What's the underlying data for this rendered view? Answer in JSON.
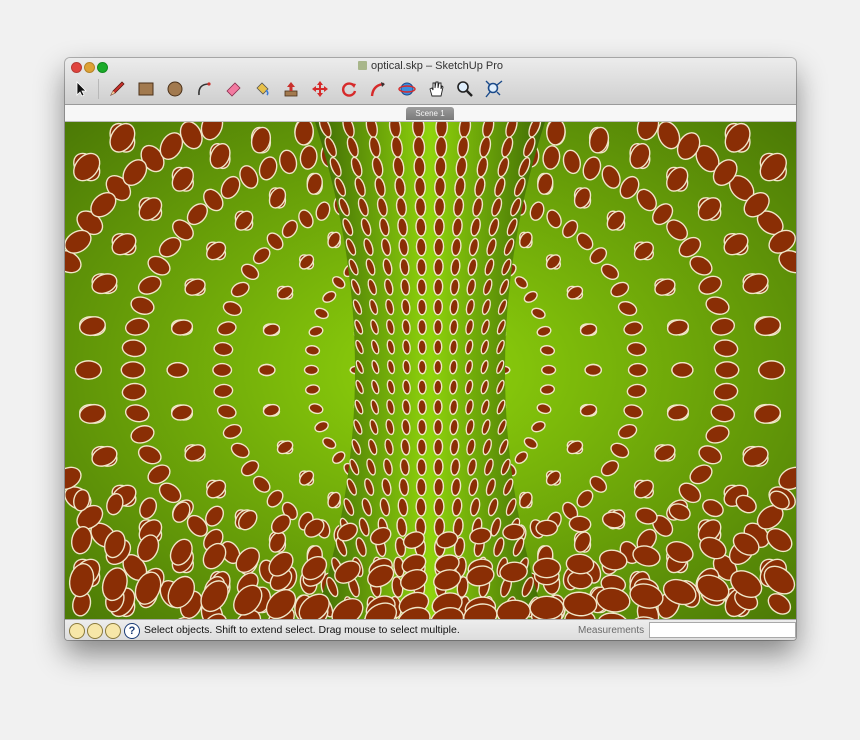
{
  "window": {
    "title": "optical.skp – SketchUp Pro",
    "traffic_lights": [
      "close",
      "minimize",
      "zoom"
    ]
  },
  "toolbar": {
    "tools": [
      {
        "name": "select-tool-icon",
        "label": "Select"
      },
      {
        "name": "pencil-tool-icon",
        "label": "Line"
      },
      {
        "name": "rectangle-tool-icon",
        "label": "Rectangle"
      },
      {
        "name": "circle-tool-icon",
        "label": "Circle"
      },
      {
        "name": "arc-tool-icon",
        "label": "Arc"
      },
      {
        "name": "eraser-tool-icon",
        "label": "Eraser"
      },
      {
        "name": "paint-bucket-tool-icon",
        "label": "Paint Bucket"
      },
      {
        "name": "push-pull-tool-icon",
        "label": "Push/Pull"
      },
      {
        "name": "move-tool-icon",
        "label": "Move"
      },
      {
        "name": "rotate-tool-icon",
        "label": "Rotate"
      },
      {
        "name": "follow-me-tool-icon",
        "label": "Follow Me"
      },
      {
        "name": "orbit-tool-icon",
        "label": "Orbit"
      },
      {
        "name": "pan-hand-tool-icon",
        "label": "Pan"
      },
      {
        "name": "zoom-tool-icon",
        "label": "Zoom"
      },
      {
        "name": "zoom-extents-tool-icon",
        "label": "Zoom Extents"
      }
    ]
  },
  "scenes": {
    "tabs": [
      "Scene 1"
    ]
  },
  "viewport": {
    "content": "optical illusion",
    "colors": {
      "bright_green": "#8fd30c",
      "dark_green": "#4c7a06",
      "dot_fill": "#8a2e05",
      "dot_rim": "#f0e6c8"
    }
  },
  "statusbar": {
    "hint": "Select objects. Shift to extend select. Drag mouse to select multiple.",
    "measurements_label": "Measurements",
    "measurements_value": ""
  }
}
